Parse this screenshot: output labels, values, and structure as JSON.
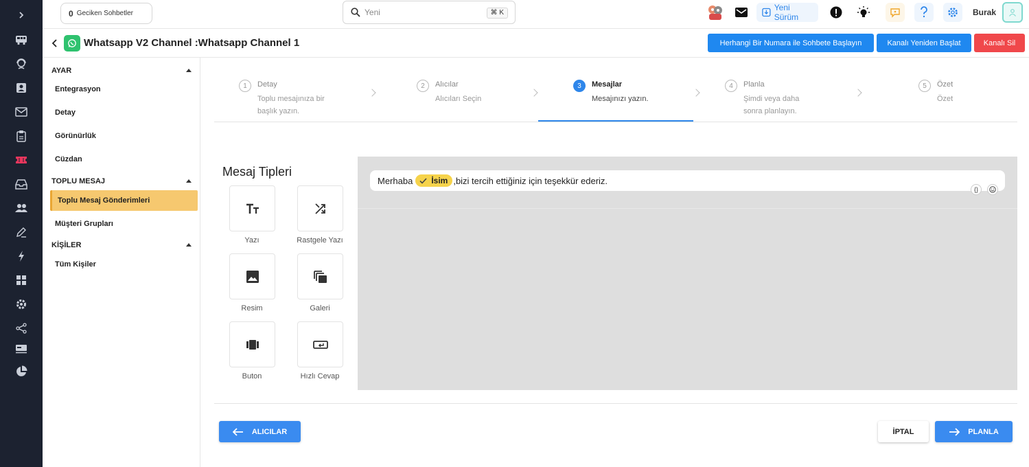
{
  "topbar": {
    "late_count": "0",
    "late_label": "Geciken Sohbetler",
    "search_placeholder": "Yeni",
    "search_shortcut": "⌘ K",
    "new_version": "Yeni Sürüm",
    "user_name": "Burak"
  },
  "header": {
    "title": "Whatsapp V2 Channel :Whatsapp Channel 1",
    "start_chat_button": "Herhangi Bir Numara ile Sohbete Başlayın",
    "restart_button": "Kanalı Yeniden Başlat",
    "delete_button": "Kanalı Sil"
  },
  "sidebar": {
    "sections": [
      {
        "title": "AYAR",
        "items": [
          "Entegrasyon",
          "Detay",
          "Görünürlük",
          "Cüzdan"
        ]
      },
      {
        "title": "TOPLU MESAJ",
        "items": [
          "Toplu Mesaj Gönderimleri",
          "Müşteri Grupları"
        ]
      },
      {
        "title": "KİŞİLER",
        "items": [
          "Tüm Kişiler"
        ]
      }
    ],
    "active_item": "Toplu Mesaj Gönderimleri"
  },
  "stepper": {
    "steps": [
      {
        "num": "1",
        "title": "Detay",
        "desc1": "Toplu mesajınıza bir",
        "desc2": "başlık yazın."
      },
      {
        "num": "2",
        "title": "Alıcılar",
        "desc1": "Alıcıları Seçin",
        "desc2": ""
      },
      {
        "num": "3",
        "title": "Mesajlar",
        "desc1": "Mesajınızı yazın.",
        "desc2": ""
      },
      {
        "num": "4",
        "title": "Planla",
        "desc1": "Şimdi veya daha",
        "desc2": "sonra planlayın."
      },
      {
        "num": "5",
        "title": "Özet",
        "desc1": "Özet",
        "desc2": ""
      }
    ],
    "active_step": 3
  },
  "message_types": {
    "title": "Mesaj Tipleri",
    "items": [
      {
        "label": "Yazı",
        "icon": "text-icon"
      },
      {
        "label": "Rastgele Yazı",
        "icon": "shuffle-icon"
      },
      {
        "label": "Resim",
        "icon": "image-icon"
      },
      {
        "label": "Galeri",
        "icon": "gallery-icon"
      },
      {
        "label": "Buton",
        "icon": "button-icon"
      },
      {
        "label": "Hızlı Cevap",
        "icon": "quick-reply-icon"
      }
    ]
  },
  "preview": {
    "text_before": "Merhaba",
    "variable": "İsim",
    "text_after": ",bizi tercih ettiğiniz için teşekkür ederiz.",
    "variable_icon": "check-icon",
    "code_icon_text": "{}",
    "emoji_icon": "emoji-icon"
  },
  "footer": {
    "back_button": "ALICILAR",
    "cancel_button": "İPTAL",
    "next_button": "PLANLA"
  },
  "colors": {
    "accent": "#2e86ea",
    "active_nav": "#f6c86f",
    "danger": "#f0484b",
    "rail": "#1c2230",
    "whatsapp": "#2fc26f"
  }
}
